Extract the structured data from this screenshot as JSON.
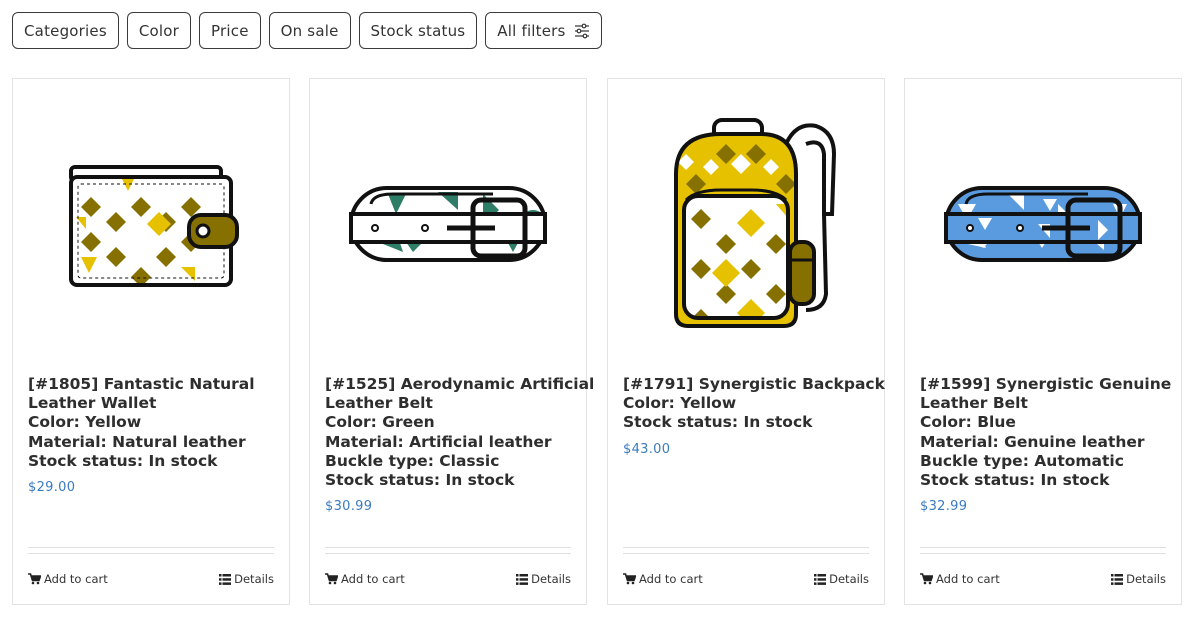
{
  "filters": [
    "Categories",
    "Color",
    "Price",
    "On sale",
    "Stock status",
    "All filters"
  ],
  "products": [
    {
      "lines": [
        "[#1805] Fantastic Natural",
        "Leather Wallet",
        "Color: Yellow",
        "Material: Natural leather",
        "Stock status: In stock"
      ],
      "price": "$29.00",
      "icon": "wallet-icon",
      "add_to_cart": "Add to cart",
      "details": "Details"
    },
    {
      "lines": [
        "[#1525] Aerodynamic Artificial",
        "Leather Belt",
        "Color: Green",
        "Material: Artificial leather",
        "Buckle type: Classic",
        "Stock status: In stock"
      ],
      "price": "$30.99",
      "icon": "belt-icon",
      "add_to_cart": "Add to cart",
      "details": "Details"
    },
    {
      "lines": [
        "[#1791] Synergistic Backpack",
        "Color: Yellow",
        "Stock status: In stock"
      ],
      "price": "$43.00",
      "icon": "backpack-icon",
      "add_to_cart": "Add to cart",
      "details": "Details"
    },
    {
      "lines": [
        "[#1599] Synergistic Genuine",
        "Leather Belt",
        "Color: Blue",
        "Material: Genuine leather",
        "Buckle type: Automatic",
        "Stock status: In stock"
      ],
      "price": "$32.99",
      "icon": "belt-icon",
      "add_to_cart": "Add to cart",
      "details": "Details"
    }
  ],
  "colors": {
    "price": "#3b7bbf",
    "yellow": "#e5c100",
    "olive": "#857000",
    "green": "#2e7d67",
    "blue": "#5a9be0"
  }
}
